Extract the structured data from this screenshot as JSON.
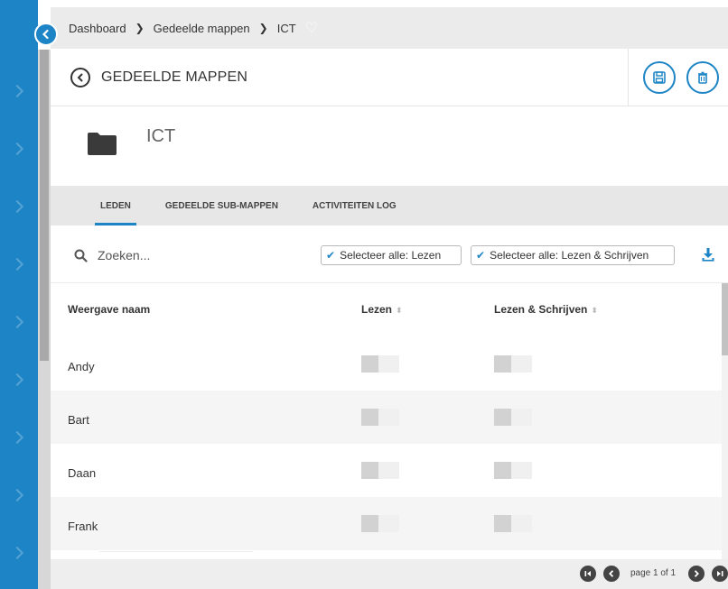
{
  "breadcrumb": {
    "items": [
      "Dashboard",
      "Gedeelde mappen",
      "ICT"
    ],
    "separator": "❯"
  },
  "header": {
    "title": "GEDEELDE MAPPEN"
  },
  "folder": {
    "name": "ICT"
  },
  "tabs": [
    {
      "label": "LEDEN",
      "active": true
    },
    {
      "label": "GEDEELDE SUB-MAPPEN",
      "active": false
    },
    {
      "label": "ACTIVITEITEN LOG",
      "active": false
    }
  ],
  "toolbar": {
    "search_placeholder": "Zoeken...",
    "select_read_label": "Selecteer alle: Lezen",
    "select_read_write_label": "Selecteer alle: Lezen & Schrijven"
  },
  "table": {
    "columns": [
      "Weergave naam",
      "Lezen",
      "Lezen & Schrijven"
    ],
    "rows": [
      {
        "name": "Andy",
        "read": false,
        "read_write": false
      },
      {
        "name": "Bart",
        "read": false,
        "read_write": false
      },
      {
        "name": "Daan",
        "read": false,
        "read_write": false
      },
      {
        "name": "Frank",
        "read": false,
        "read_write": false
      }
    ]
  },
  "pager": {
    "text": "page 1 of 1"
  },
  "colors": {
    "accent": "#1d85c6",
    "sidebar": "#1d85c6"
  }
}
